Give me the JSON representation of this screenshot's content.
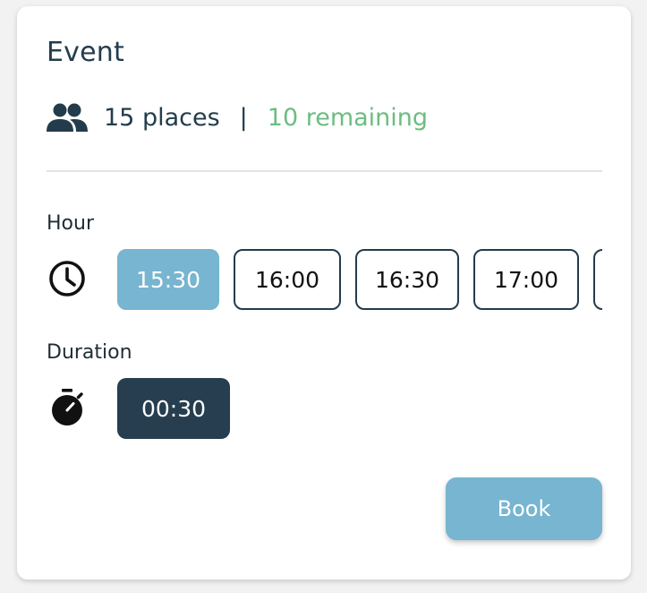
{
  "event": {
    "title": "Event",
    "places": "15 places",
    "separator": "|",
    "remaining": "10 remaining"
  },
  "hour": {
    "label": "Hour",
    "slots": [
      "15:30",
      "16:00",
      "16:30",
      "17:00",
      ""
    ],
    "selected": "15:30"
  },
  "duration": {
    "label": "Duration",
    "value": "00:30"
  },
  "actions": {
    "book_label": "Book"
  },
  "icons": {
    "people": "people-icon",
    "clock": "clock-icon",
    "timer": "timer-icon"
  },
  "colors": {
    "navy": "#233c4c",
    "accent_blue": "#77b5d0",
    "remaining_green": "#6cbd80",
    "duration_dark": "#263e4f"
  }
}
